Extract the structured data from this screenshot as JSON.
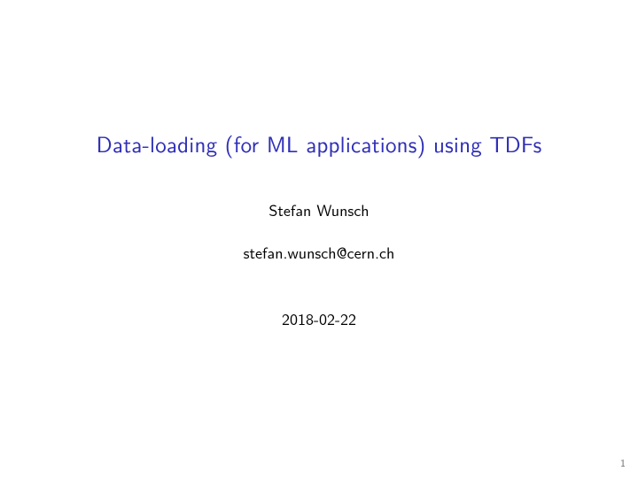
{
  "slide": {
    "title": "Data-loading (for ML applications) using TDFs",
    "author": "Stefan Wunsch",
    "email": "stefan.wunsch@cern.ch",
    "date": "2018-02-22",
    "page_number": "1"
  }
}
